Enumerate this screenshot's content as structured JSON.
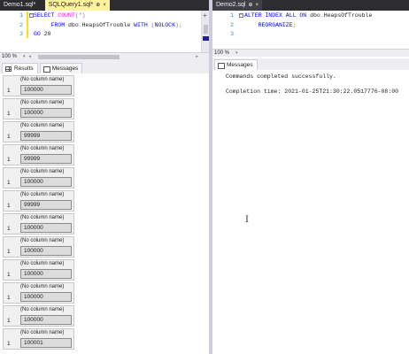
{
  "left_pane": {
    "tabs": [
      {
        "label": "Demo1.sql*",
        "close": "×"
      },
      {
        "label": "SQLQuery1.sql*",
        "pin": "⊕",
        "close": "×"
      }
    ],
    "lines": [
      {
        "num": "1",
        "tokens": [
          {
            "t": "SELECT ",
            "c": "kw"
          },
          {
            "t": "COUNT",
            "c": "fn"
          },
          {
            "t": "(*)",
            "c": "gray"
          }
        ]
      },
      {
        "num": "2",
        "tokens": [
          {
            "t": "     FROM ",
            "c": "kw"
          },
          {
            "t": "dbo",
            "c": ""
          },
          {
            "t": ".",
            "c": "gray"
          },
          {
            "t": "HeapsOfTrouble ",
            "c": ""
          },
          {
            "t": "WITH ",
            "c": "kw"
          },
          {
            "t": "(",
            "c": "gray"
          },
          {
            "t": "NOLOCK",
            "c": "kw"
          },
          {
            "t": ");",
            "c": "gray"
          }
        ]
      },
      {
        "num": "3",
        "tokens": [
          {
            "t": "GO ",
            "c": "kw"
          },
          {
            "t": "20",
            "c": ""
          }
        ]
      }
    ],
    "zoom": "100 %",
    "result_tabs": [
      {
        "label": "Results",
        "selected": true
      },
      {
        "label": "Messages",
        "selected": false
      }
    ],
    "result_sets": [
      {
        "header": "(No column name)",
        "row": "1",
        "value": "100000"
      },
      {
        "header": "(No column name)",
        "row": "1",
        "value": "100000"
      },
      {
        "header": "(No column name)",
        "row": "1",
        "value": "99999"
      },
      {
        "header": "(No column name)",
        "row": "1",
        "value": "99999"
      },
      {
        "header": "(No column name)",
        "row": "1",
        "value": "100000"
      },
      {
        "header": "(No column name)",
        "row": "1",
        "value": "99999"
      },
      {
        "header": "(No column name)",
        "row": "1",
        "value": "100000"
      },
      {
        "header": "(No column name)",
        "row": "1",
        "value": "100000"
      },
      {
        "header": "(No column name)",
        "row": "1",
        "value": "100000"
      },
      {
        "header": "(No column name)",
        "row": "1",
        "value": "100000"
      },
      {
        "header": "(No column name)",
        "row": "1",
        "value": "100000"
      },
      {
        "header": "(No column name)",
        "row": "1",
        "value": "100001"
      }
    ]
  },
  "right_pane": {
    "tabs": [
      {
        "label": "Demo2.sql",
        "pin": "⊕",
        "close": "×"
      }
    ],
    "lines": [
      {
        "num": "1",
        "tokens": [
          {
            "t": "ALTER INDEX ALL ON ",
            "c": "kw"
          },
          {
            "t": "dbo",
            "c": ""
          },
          {
            "t": ".",
            "c": "gray"
          },
          {
            "t": "HeapsOfTrouble",
            "c": ""
          }
        ]
      },
      {
        "num": "2",
        "tokens": [
          {
            "t": "    REORGANIZE",
            "c": "kw"
          },
          {
            "t": ";",
            "c": "gray"
          }
        ]
      },
      {
        "num": "3",
        "tokens": []
      }
    ],
    "zoom": "100 %",
    "message_tab": "Messages",
    "messages": [
      "Commands completed successfully.",
      "",
      "Completion time: 2021-01-25T21:30:22.0517776-08:00"
    ]
  },
  "icons": [
    "grid-icon",
    "messages-icon",
    "add-icon",
    "collapse-icon",
    "i-beam-cursor-icon"
  ]
}
